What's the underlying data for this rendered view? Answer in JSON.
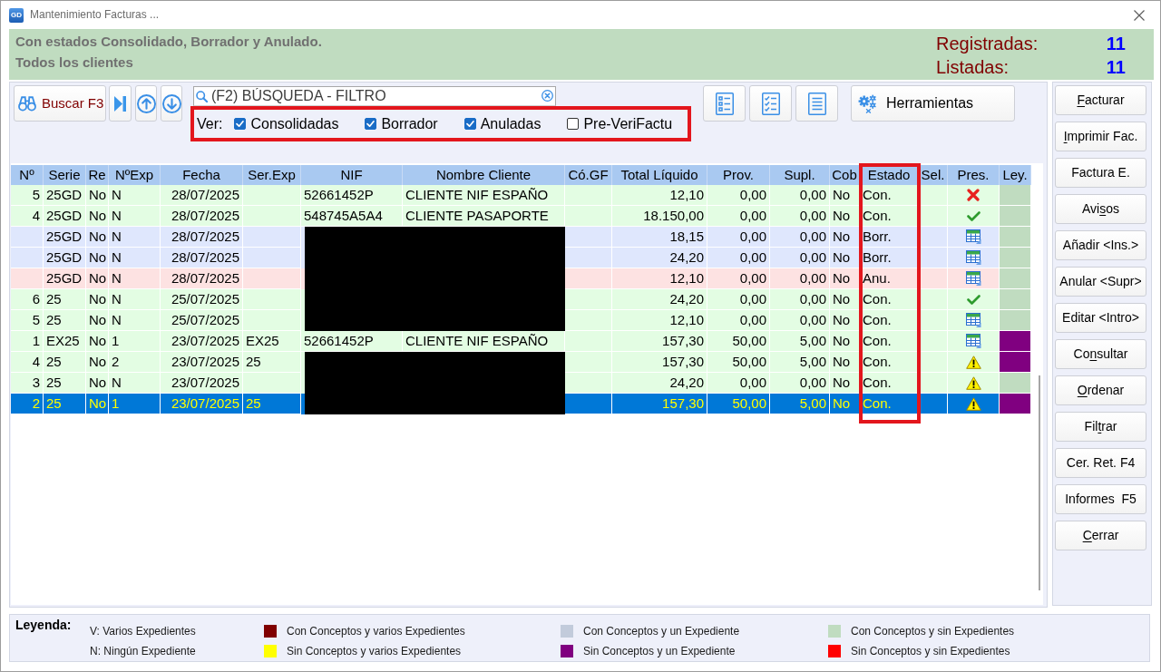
{
  "window": {
    "logo_text": "GD",
    "title": "Mantenimiento Facturas ..."
  },
  "summary": {
    "lines": [
      "Con estados Consolidado, Borrador y Anulado.",
      "Todos los clientes"
    ],
    "counters": [
      {
        "label": "Registradas:",
        "value": "11"
      },
      {
        "label": "Listadas:",
        "value": "11"
      }
    ]
  },
  "toolbar": {
    "search_button": "Buscar F3",
    "search": {
      "placeholder": "(F2) BÚSQUEDA - FILTRO"
    },
    "tools_button": "Herramientas"
  },
  "filters": {
    "label": "Ver:",
    "highlighted": true,
    "options": [
      {
        "label": "Consolidadas",
        "checked": true
      },
      {
        "label": "Borrador",
        "checked": true
      },
      {
        "label": "Anuladas",
        "checked": true
      },
      {
        "label": "Pre-VeriFactu",
        "checked": false
      }
    ]
  },
  "table": {
    "columns": [
      {
        "label": "Nº",
        "highlighted": false
      },
      {
        "label": "Serie",
        "highlighted": false
      },
      {
        "label": "Re",
        "highlighted": false
      },
      {
        "label": "NºExp",
        "highlighted": false
      },
      {
        "label": "Fecha",
        "highlighted": false
      },
      {
        "label": "Ser.Exp",
        "highlighted": false
      },
      {
        "label": "NIF",
        "highlighted": false
      },
      {
        "label": "Nombre Cliente",
        "highlighted": false
      },
      {
        "label": "Có.GF",
        "highlighted": false
      },
      {
        "label": "Total Líquido",
        "highlighted": false
      },
      {
        "label": "Prov.",
        "highlighted": false
      },
      {
        "label": "Supl.",
        "highlighted": false
      },
      {
        "label": "Cob",
        "highlighted": false
      },
      {
        "label": "Estado",
        "highlighted": true
      },
      {
        "label": "Sel.",
        "highlighted": false
      },
      {
        "label": "Pres.",
        "highlighted": false
      },
      {
        "label": "Ley.",
        "highlighted": false
      }
    ],
    "rows": [
      {
        "number": "5",
        "series": "25GD",
        "re": "No",
        "exp_no": "N",
        "date": "28/07/2025",
        "nif": "52661452P",
        "client": "CLIENTE NIF ESPAÑO",
        "total": "12,10",
        "prov": "0,00",
        "supl": "0,00",
        "cob": "No",
        "status": "Con.",
        "pres": {
          "kind": "rejected"
        },
        "color": "#c0dcc0",
        "kind": "consolidated",
        "selected": false,
        "redacted": false
      },
      {
        "number": "4",
        "series": "25GD",
        "re": "No",
        "exp_no": "N",
        "date": "28/07/2025",
        "nif": "548745A5A4",
        "client": "CLIENTE PASAPORTE",
        "total": "18.150,00",
        "prov": "0,00",
        "supl": "0,00",
        "cob": "No",
        "status": "Con.",
        "pres": {
          "kind": "accepted"
        },
        "color": "#c0dcc0",
        "kind": "consolidated",
        "selected": false,
        "redacted": false
      },
      {
        "series": "25GD",
        "re": "No",
        "exp_no": "N",
        "date": "28/07/2025",
        "total": "18,15",
        "prov": "0,00",
        "supl": "0,00",
        "cob": "No",
        "status": "Borr.",
        "pres": {
          "kind": "pending"
        },
        "color": "#c0dcc0",
        "kind": "draft",
        "selected": false,
        "redacted": true
      },
      {
        "series": "25GD",
        "re": "No",
        "exp_no": "N",
        "date": "28/07/2025",
        "total": "24,20",
        "prov": "0,00",
        "supl": "0,00",
        "cob": "No",
        "status": "Borr.",
        "pres": {
          "kind": "pending"
        },
        "color": "#c0dcc0",
        "kind": "draft",
        "selected": false,
        "redacted": true
      },
      {
        "series": "25GD",
        "re": "No",
        "exp_no": "N",
        "date": "28/07/2025",
        "total": "12,10",
        "prov": "0,00",
        "supl": "0,00",
        "cob": "No",
        "status": "Anu.",
        "pres": {
          "kind": "pending"
        },
        "color": "#c0dcc0",
        "kind": "cancelled",
        "selected": false,
        "redacted": true
      },
      {
        "number": "6",
        "series": "25",
        "re": "No",
        "exp_no": "N",
        "date": "25/07/2025",
        "total": "24,20",
        "prov": "0,00",
        "supl": "0,00",
        "cob": "No",
        "status": "Con.",
        "pres": {
          "kind": "accepted"
        },
        "color": "#c0dcc0",
        "kind": "consolidated",
        "selected": false,
        "redacted": true
      },
      {
        "number": "5",
        "series": "25",
        "re": "No",
        "exp_no": "N",
        "date": "25/07/2025",
        "total": "12,10",
        "prov": "0,00",
        "supl": "0,00",
        "cob": "No",
        "status": "Con.",
        "pres": {
          "kind": "pending"
        },
        "color": "#c0dcc0",
        "kind": "consolidated",
        "selected": false,
        "redacted": true
      },
      {
        "number": "1",
        "series": "EX25",
        "re": "No",
        "exp_no": "1",
        "date": "23/07/2025",
        "exp_series": "EX25",
        "nif": "52661452P",
        "client": "CLIENTE NIF ESPAÑO",
        "total": "157,30",
        "prov": "50,00",
        "supl": "5,00",
        "cob": "No",
        "status": "Con.",
        "pres": {
          "kind": "pending"
        },
        "color": "#800080",
        "kind": "consolidated",
        "selected": false,
        "redacted": false
      },
      {
        "number": "4",
        "series": "25",
        "re": "No",
        "exp_no": "2",
        "date": "23/07/2025",
        "exp_series": "25",
        "total": "157,30",
        "prov": "50,00",
        "supl": "5,00",
        "cob": "No",
        "status": "Con.",
        "pres": {
          "kind": "warning"
        },
        "color": "#800080",
        "kind": "consolidated",
        "selected": false,
        "redacted": true
      },
      {
        "number": "3",
        "series": "25",
        "re": "No",
        "exp_no": "N",
        "date": "23/07/2025",
        "total": "24,20",
        "prov": "0,00",
        "supl": "0,00",
        "cob": "No",
        "status": "Con.",
        "pres": {
          "kind": "warning"
        },
        "color": "#c0dcc0",
        "kind": "consolidated",
        "selected": false,
        "redacted": true
      },
      {
        "number": "2",
        "series": "25",
        "re": "No",
        "exp_no": "1",
        "date": "23/07/2025",
        "exp_series": "25",
        "total": "157,30",
        "prov": "50,00",
        "supl": "5,00",
        "cob": "No",
        "status": "Con.",
        "pres": {
          "kind": "warning"
        },
        "color": "#800080",
        "kind": "consolidated",
        "selected": true,
        "redacted": true
      }
    ]
  },
  "actions": [
    {
      "access_key": "F",
      "label_end": "acturar"
    },
    {
      "access_key": "I",
      "label_end": "mprimir Fac."
    },
    {
      "label": "Factura E."
    },
    {
      "label_start": "Avi",
      "access_key": "s",
      "label_end": "os"
    },
    {
      "label": "Añadir <Ins.>"
    },
    {
      "label": "Anular <Supr>"
    },
    {
      "label": "Editar <Intro>"
    },
    {
      "label_start": "Co",
      "access_key": "n",
      "label_end": "sultar"
    },
    {
      "access_key": "O",
      "label_end": "rdenar"
    },
    {
      "label_start": "Fil",
      "access_key": "t",
      "label_end": "rar"
    },
    {
      "label": "Cer. Ret. F4"
    },
    {
      "label": "Informes  F5"
    },
    {
      "access_key": "C",
      "label_end": "errar"
    }
  ],
  "legend": {
    "title": "Leyenda:",
    "items": [
      {
        "kind": "abbreviation",
        "text": "V: Varios Expedientes"
      },
      {
        "kind": "color",
        "color": "#800000",
        "text": "Con Conceptos y varios Expedientes"
      },
      {
        "kind": "color",
        "color": "#c2cbdb",
        "text": "Con Conceptos y un Expediente"
      },
      {
        "kind": "color",
        "color": "#c0dcc0",
        "text": "Con Conceptos y sin Expedientes"
      },
      {
        "kind": "abbreviation",
        "text": "N: Ningún Expediente"
      },
      {
        "kind": "color",
        "color": "#ffff00",
        "text": "Sin Conceptos y varios Expedientes"
      },
      {
        "kind": "color",
        "color": "#800080",
        "text": "Sin Conceptos y un Expediente"
      },
      {
        "kind": "color",
        "color": "#ff0000",
        "text": "Sin Conceptos y sin Expedientes"
      }
    ]
  }
}
